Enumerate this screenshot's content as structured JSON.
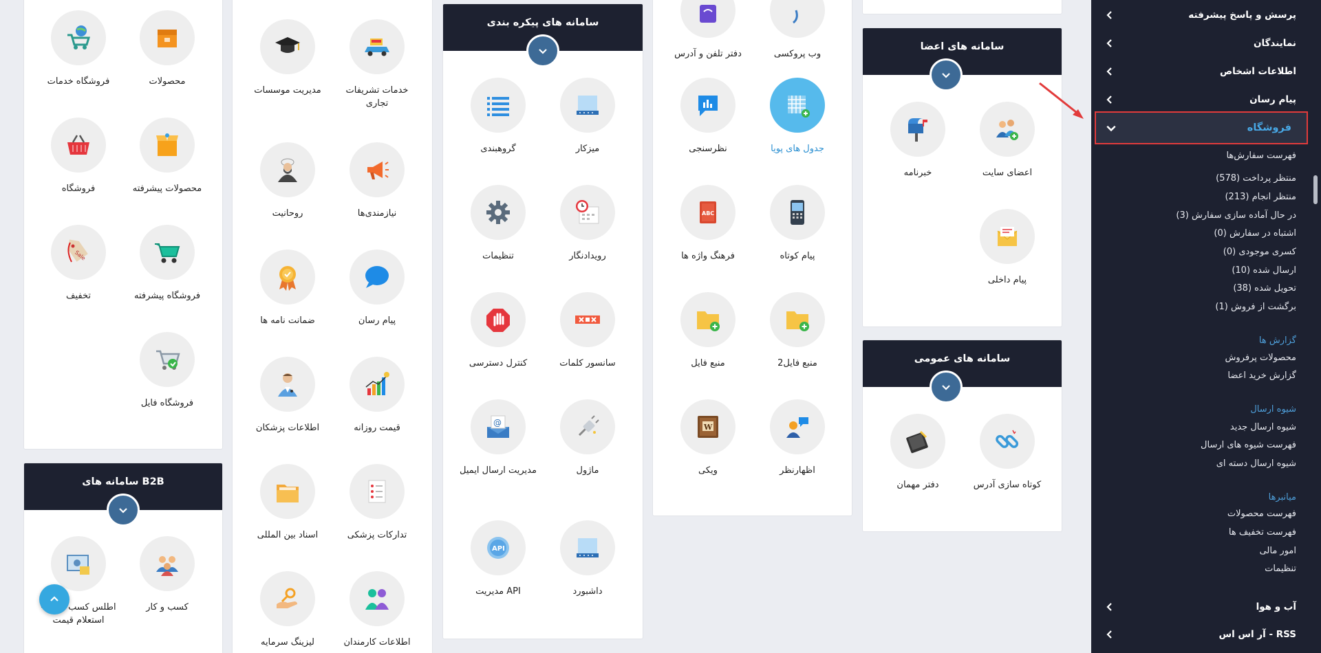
{
  "accent": "#48a8e6",
  "highlight_border": "#e23b3b",
  "col1": {
    "tiles": [
      {
        "label": "فروشگاه خدمات",
        "icon": "shop-cart-globe-icon"
      },
      {
        "label": "محصولات",
        "icon": "box-icon"
      },
      {
        "label": "فروشگاه",
        "icon": "basket-icon"
      },
      {
        "label": "محصولات پیشرفته",
        "icon": "open-box-icon"
      },
      {
        "label": "تخفیف",
        "icon": "sale-tag-icon"
      },
      {
        "label": "فروشگاه پیشرفته",
        "icon": "shopping-cart-icon"
      },
      {
        "label": "فروشگاه فایل",
        "icon": "file-cart-icon"
      }
    ]
  },
  "b2b": {
    "title": "سامانه های B2B",
    "tiles": [
      {
        "label": "اطلس کسب و کار - استعلام قیمت",
        "icon": "atlas-icon"
      },
      {
        "label": "کسب و کار",
        "icon": "people-icon"
      }
    ]
  },
  "col2": {
    "tiles": [
      {
        "label": "مدیریت موسسات",
        "icon": "graduation-cap-icon"
      },
      {
        "label": "خدمات تشریفات تجاری",
        "icon": "car-icon"
      },
      {
        "label": "روحانیت",
        "icon": "cleric-icon"
      },
      {
        "label": "نیازمندی‌ها",
        "icon": "megaphone-icon"
      },
      {
        "label": "ضمانت نامه ها",
        "icon": "award-badge-icon"
      },
      {
        "label": "پیام رسان",
        "icon": "chat-bubble-icon"
      },
      {
        "label": "اطلاعات پزشکان",
        "icon": "doctor-icon"
      },
      {
        "label": "قیمت روزانه",
        "icon": "bar-chart-icon"
      },
      {
        "label": "اسناد بین المللی",
        "icon": "folder-files-icon"
      },
      {
        "label": "تدارکات پزشکی",
        "icon": "medical-list-icon"
      },
      {
        "label": "لیزینگ سرمایه",
        "icon": "hand-key-icon"
      },
      {
        "label": "اطلاعات کارمندان",
        "icon": "employees-icon"
      }
    ]
  },
  "packaged": {
    "title": "سامانه های پیکره بندی",
    "tiles": [
      {
        "label": "گروهبندی",
        "icon": "list-icon"
      },
      {
        "label": "میزکار",
        "icon": "desk-icon"
      },
      {
        "label": "تنظیمات",
        "icon": "gear-icon"
      },
      {
        "label": "رویدادنگار",
        "icon": "calendar-clock-icon"
      },
      {
        "label": "کنترل دسترسی",
        "icon": "stop-hand-icon"
      },
      {
        "label": "سانسور کلمات",
        "icon": "censor-icon"
      },
      {
        "label": "مدیریت ارسال ایمیل",
        "icon": "email-icon"
      },
      {
        "label": "ماژول",
        "icon": "plug-icon"
      },
      {
        "label": "مدیریت API",
        "icon": "api-icon"
      },
      {
        "label": "داشبورد",
        "icon": "dashboard-icon"
      }
    ]
  },
  "col4": {
    "tiles": [
      {
        "label": "دفتر تلفن و آدرس",
        "icon": "phonebook-icon"
      },
      {
        "label": "وب پروکسی",
        "icon": "web-proxy-icon"
      },
      {
        "label": "نظرسنجی",
        "icon": "poll-icon"
      },
      {
        "label": "جدول های پویا",
        "icon": "grid-table-icon"
      },
      {
        "label": "فرهنگ واژه ها",
        "icon": "dictionary-icon"
      },
      {
        "label": "پیام کوتاه",
        "icon": "sms-phone-icon"
      },
      {
        "label": "منبع فایل",
        "icon": "add-folder-icon"
      },
      {
        "label": "منبع فایل2",
        "icon": "add-folder-2-icon"
      },
      {
        "label": "ویکی",
        "icon": "wiki-icon"
      },
      {
        "label": "اظهارنظر",
        "icon": "comment-user-icon"
      }
    ]
  },
  "members": {
    "title": "سامانه های اعضا",
    "tiles": [
      {
        "label": "خبرنامه",
        "icon": "mailbox-icon"
      },
      {
        "label": "اعضای سایت",
        "icon": "add-users-icon"
      },
      {
        "label": "پیام داخلی",
        "icon": "envelope-icon"
      }
    ]
  },
  "general": {
    "title": "سامانه های عمومی",
    "tiles": [
      {
        "label": "دفتر مهمان",
        "icon": "guestbook-icon"
      },
      {
        "label": "کوتاه سازی آدرس",
        "icon": "link-icon"
      }
    ]
  },
  "sidebar": {
    "items": [
      {
        "label": "پرسش و پاسخ پیشرفته"
      },
      {
        "label": "نمایندگان"
      },
      {
        "label": "اطلاعات اشخاص"
      },
      {
        "label": "پیام رسان"
      }
    ],
    "active": {
      "label": "فروشگاه"
    },
    "subs": [
      {
        "label": "فهرست سفارش‌ها",
        "head": false
      },
      {
        "label": "منتظر پرداخت (578)",
        "head": false
      },
      {
        "label": "منتظر انجام (213)",
        "head": false
      },
      {
        "label": "در حال آماده سازی سفارش (3)",
        "head": false
      },
      {
        "label": "اشتباه در سفارش (0)",
        "head": false
      },
      {
        "label": "کسری موجودی (0)",
        "head": false
      },
      {
        "label": "ارسال شده (10)",
        "head": false
      },
      {
        "label": "تحویل شده (38)",
        "head": false
      },
      {
        "label": "برگشت از فروش (1)",
        "head": false
      },
      {
        "label": "گزارش ها",
        "head": true
      },
      {
        "label": "محصولات پرفروش",
        "head": false
      },
      {
        "label": "گزارش خرید اعضا",
        "head": false
      },
      {
        "label": "شیوه ارسال",
        "head": true
      },
      {
        "label": "شیوه ارسال جدید",
        "head": false
      },
      {
        "label": "فهرست شیوه های ارسال",
        "head": false
      },
      {
        "label": "شیوه ارسال دسته ای",
        "head": false
      },
      {
        "label": "میانبرها",
        "head": true
      },
      {
        "label": "فهرست محصولات",
        "head": false
      },
      {
        "label": "فهرست تخفیف ها",
        "head": false
      },
      {
        "label": "امور مالی",
        "head": false
      },
      {
        "label": "تنظیمات",
        "head": false
      }
    ],
    "bottom": [
      {
        "label": "آب و هوا"
      },
      {
        "label": "آر اس اس - RSS"
      }
    ]
  }
}
